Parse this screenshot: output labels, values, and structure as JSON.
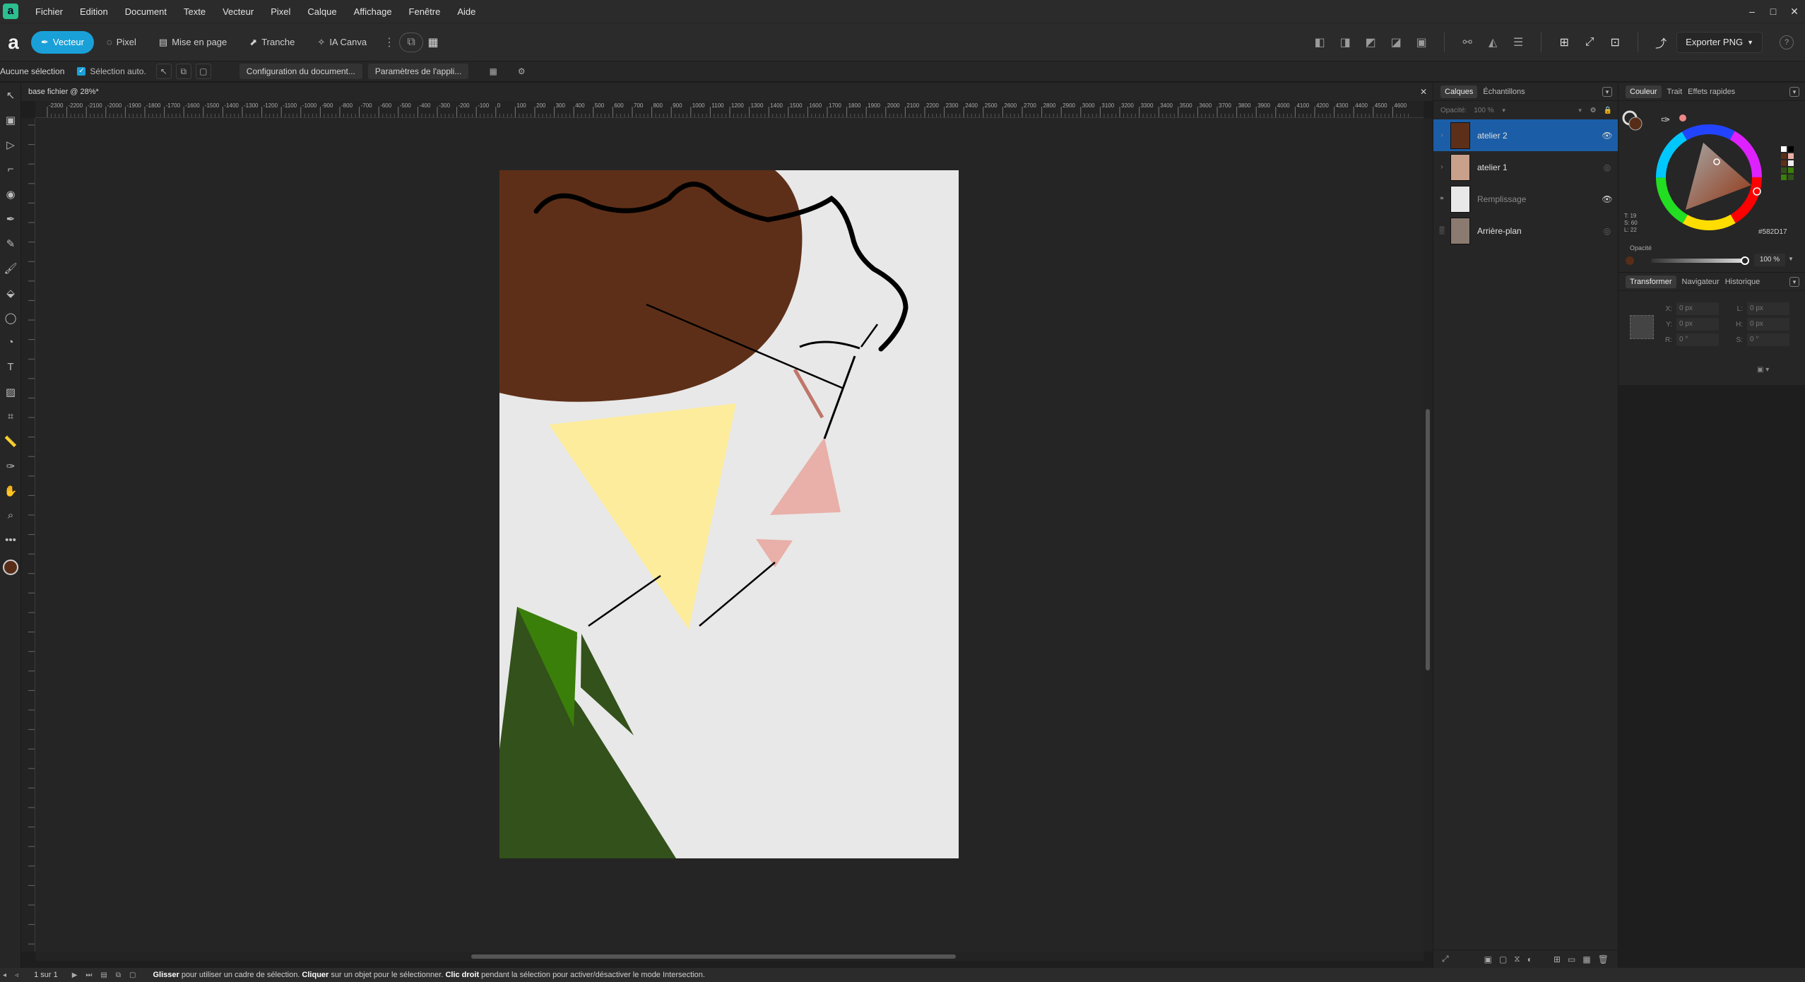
{
  "menu": [
    "Fichier",
    "Edition",
    "Document",
    "Texte",
    "Vecteur",
    "Pixel",
    "Calque",
    "Affichage",
    "Fenêtre",
    "Aide"
  ],
  "window_controls": [
    "–",
    "□",
    "✕"
  ],
  "personas": [
    {
      "label": "Vecteur",
      "icon": "vector-icon",
      "active": true
    },
    {
      "label": "Pixel",
      "icon": "pixel-icon",
      "active": false
    },
    {
      "label": "Mise en page",
      "icon": "layout-icon",
      "active": false
    },
    {
      "label": "Tranche",
      "icon": "slice-icon",
      "active": false
    },
    {
      "label": "IA Canva",
      "icon": "ai-icon",
      "active": false
    }
  ],
  "export_label": "Exporter PNG",
  "help_label": "?",
  "context": {
    "selection": "Aucune sélection",
    "auto_select": "Sélection auto.",
    "doc_setup": "Configuration du document...",
    "app_settings": "Paramètres de l'appli..."
  },
  "document_tab": "base fichier @ 28%*",
  "ruler_ticks": [
    "-2300",
    "-2200",
    "-2100",
    "-2000",
    "-1900",
    "-1800",
    "-1700",
    "-1600",
    "-1500",
    "-1400",
    "-1300",
    "-1200",
    "-1100",
    "-1000",
    "-900",
    "-800",
    "-700",
    "-600",
    "-500",
    "-400",
    "-300",
    "-200",
    "-100",
    "0",
    "100",
    "200",
    "300",
    "400",
    "500",
    "600",
    "700",
    "800",
    "900",
    "1000",
    "1100",
    "1200",
    "1300",
    "1400",
    "1500",
    "1600",
    "1700",
    "1800",
    "1900",
    "2000",
    "2100",
    "2200",
    "2300",
    "2400",
    "2500",
    "2600",
    "2700",
    "2800",
    "2900",
    "3000",
    "3100",
    "3200",
    "3300",
    "3400",
    "3500",
    "3600",
    "3700",
    "3800",
    "3900",
    "4000",
    "4100",
    "4200",
    "4300",
    "4400",
    "4500",
    "4600"
  ],
  "layers_panel": {
    "tabs": [
      "Calques",
      "Échantillons"
    ],
    "opacity_label": "Opacité:",
    "opacity_value": "100 %",
    "layers": [
      {
        "name": "atelier 2",
        "selected": true,
        "visible": true,
        "dim": false
      },
      {
        "name": "atelier 1",
        "selected": false,
        "visible": false,
        "dim": false
      },
      {
        "name": "Remplissage",
        "selected": false,
        "visible": true,
        "dim": true
      },
      {
        "name": "Arrière-plan",
        "selected": false,
        "visible": false,
        "dim": false
      }
    ]
  },
  "color_panel": {
    "tabs": [
      "Couleur",
      "Trait",
      "Effets rapides"
    ],
    "hsl": [
      "T: 19",
      "S: 60",
      "L: 22"
    ],
    "hex": "582D17",
    "opacity_label": "Opacité",
    "opacity_value": "100 %",
    "current_color": "#582D17"
  },
  "transform_panel": {
    "tabs": [
      "Transformer",
      "Navigateur",
      "Historique"
    ],
    "fields": [
      {
        "label": "X:",
        "value": "0 px"
      },
      {
        "label": "L:",
        "value": "0 px"
      },
      {
        "label": "Y:",
        "value": "0 px"
      },
      {
        "label": "H:",
        "value": "0 px"
      },
      {
        "label": "R:",
        "value": "0 °"
      },
      {
        "label": "S:",
        "value": "0 °"
      }
    ]
  },
  "status": {
    "pages": "1 sur 1",
    "hint_bold1": "Glisser",
    "hint1": " pour utiliser un cadre de sélection. ",
    "hint_bold2": "Cliquer",
    "hint2": " sur un objet pour le sélectionner. ",
    "hint_bold3": "Clic droit",
    "hint3": " pendant la sélection pour activer/désactiver le mode Intersection."
  },
  "colors": {
    "accent": "#1aa0d8",
    "brown": "#582D17",
    "hair": "#5e2f18",
    "cone": "#fcec9c",
    "pink": "#e8b0a8",
    "green_dark": "#33511b",
    "green_bright": "#3a7f0a",
    "artboard": "#e8e8e8"
  }
}
